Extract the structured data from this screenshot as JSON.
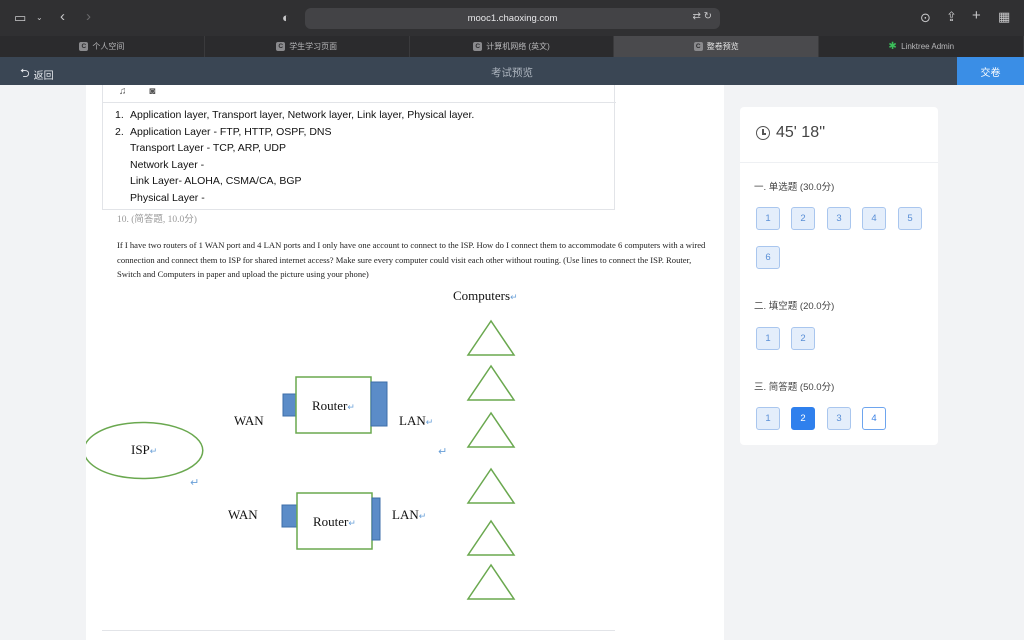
{
  "browser": {
    "url": "mooc1.chaoxing.com",
    "icons": [
      "sidebar-icon",
      "chevron-down-icon",
      "back-icon",
      "forward-icon",
      "shield-icon",
      "translate-icon",
      "reload-icon",
      "download-icon",
      "share-icon",
      "new-tab-icon",
      "tab-overview-icon"
    ]
  },
  "tabs": [
    {
      "fav": "C",
      "label": "个人空间"
    },
    {
      "fav": "C",
      "label": "学生学习页面"
    },
    {
      "fav": "C",
      "label": "计算机网络 (英文)"
    },
    {
      "fav": "C",
      "label": "整卷预览"
    },
    {
      "fav": "✱",
      "label": "Linktree Admin"
    }
  ],
  "header": {
    "back_label": "返回",
    "title": "考试预览",
    "submit_label": "交卷"
  },
  "answer": {
    "tools": "♫ ◙",
    "lines": [
      {
        "num": "1.",
        "text": "Application layer, Transport layer, Network layer, Link layer, Physical layer."
      },
      {
        "num": "2.",
        "text": "Application Layer - FTP, HTTP, OSPF, DNS"
      },
      {
        "num": "",
        "text": "Transport Layer - TCP, ARP, UDP"
      },
      {
        "num": "",
        "text": "Network Layer -"
      },
      {
        "num": "",
        "text": "Link Layer- ALOHA, CSMA/CA, BGP"
      },
      {
        "num": "",
        "text": "Physical Layer -"
      }
    ]
  },
  "question": {
    "label": "10. (简答题, 10.0分)",
    "text": "If I have two routers of 1 WAN port and 4 LAN ports and I only have one account to connect to the ISP. How do I connect them to accommodate 6 computers with a wired connection and connect them to ISP for shared internet access? Make sure every computer could visit each other without routing. (Use lines to connect the ISP. Router, Switch and Computers in paper and upload the picture using your phone)"
  },
  "diagram": {
    "computers_label": "Computers",
    "isp_label": "ISP",
    "router_label": "Router",
    "wan_label": "WAN",
    "lan_label": "LAN",
    "return_mark": "↵"
  },
  "timer": "45' 18''",
  "sections": [
    {
      "title": "一. 单选题 (30.0分)",
      "questions": [
        "1",
        "2",
        "3",
        "4",
        "5",
        "6"
      ]
    },
    {
      "title": "二. 填空题 (20.0分)",
      "questions": [
        "1",
        "2"
      ]
    },
    {
      "title": "三. 简答题 (50.0分)",
      "questions": [
        "1",
        "2",
        "3",
        "4"
      ]
    }
  ],
  "colors": {
    "accent": "#2f80ed",
    "header_bg": "#3a4654",
    "diagram_green": "#6aa84f",
    "port_blue": "#5b8cc8"
  }
}
